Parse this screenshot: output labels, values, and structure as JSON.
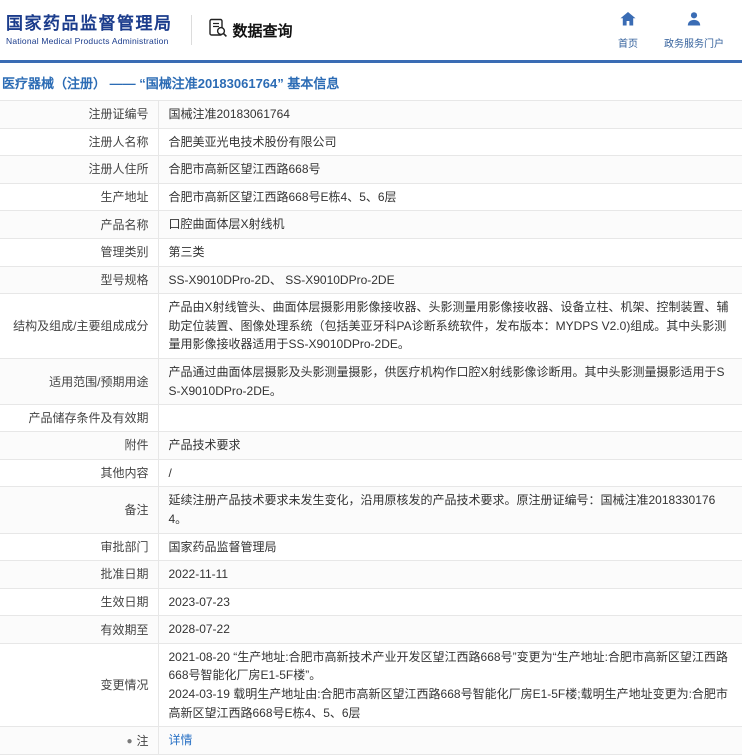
{
  "header": {
    "brand": {
      "title": "国家药品监督管理局",
      "subtitle": "National Medical Products Administration"
    },
    "query": {
      "label": "数据查询",
      "icon": "data-query-icon"
    },
    "nav": [
      {
        "label": "首页",
        "icon": "home-icon"
      },
      {
        "label": "政务服务门户",
        "icon": "portal-icon"
      }
    ]
  },
  "breadcrumb": "医疗器械（注册） —— “国械注准20183061764” 基本信息",
  "table": {
    "rows": [
      {
        "label": "注册证编号",
        "value": "国械注准20183061764"
      },
      {
        "label": "注册人名称",
        "value": "合肥美亚光电技术股份有限公司"
      },
      {
        "label": "注册人住所",
        "value": "合肥市高新区望江西路668号"
      },
      {
        "label": "生产地址",
        "value": "合肥市高新区望江西路668号E栋4、5、6层"
      },
      {
        "label": "产品名称",
        "value": "口腔曲面体层X射线机"
      },
      {
        "label": "管理类别",
        "value": "第三类"
      },
      {
        "label": "型号规格",
        "value": "SS-X9010DPro-2D、 SS-X9010DPro-2DE"
      },
      {
        "label": "结构及组成/主要组成成分",
        "value": "产品由X射线管头、曲面体层摄影用影像接收器、头影测量用影像接收器、设备立柱、机架、控制装置、辅助定位装置、图像处理系统（包括美亚牙科PA诊断系统软件，发布版本：MYDPS V2.0)组成。其中头影测量用影像接收器适用于SS-X9010DPro-2DE。"
      },
      {
        "label": "适用范围/预期用途",
        "value": "产品通过曲面体层摄影及头影测量摄影，供医疗机构作口腔X射线影像诊断用。其中头影测量摄影适用于SS-X9010DPro-2DE。"
      },
      {
        "label": "产品储存条件及有效期",
        "value": ""
      },
      {
        "label": "附件",
        "value": "产品技术要求"
      },
      {
        "label": "其他内容",
        "value": "/"
      },
      {
        "label": "备注",
        "value": "延续注册产品技术要求未发生变化，沿用原核发的产品技术要求。原注册证编号：国械注准20183301764。"
      },
      {
        "label": "审批部门",
        "value": "国家药品监督管理局"
      },
      {
        "label": "批准日期",
        "value": "2022-11-11"
      },
      {
        "label": "生效日期",
        "value": "2023-07-23"
      },
      {
        "label": "有效期至",
        "value": "2028-07-22"
      },
      {
        "label": "变更情况",
        "value": "2021-08-20 “生产地址:合肥市高新技术产业开发区望江西路668号”变更为“生产地址:合肥市高新区望江西路668号智能化厂房E1-5F楼”。\n2024-03-19 载明生产地址由:合肥市高新区望江西路668号智能化厂房E1-5F楼;载明生产地址变更为:合肥市高新区望江西路668号E栋4、5、6层"
      },
      {
        "label": "注",
        "value": "详情",
        "link": true,
        "icon": "note-icon"
      }
    ]
  },
  "icons": {
    "note-icon": "●"
  },
  "colors": {
    "brand_blue": "#1b3c8c",
    "bar_blue": "#3a6cb4",
    "breadcrumb_blue": "#2c6cb5",
    "link_blue": "#2a72c5"
  }
}
